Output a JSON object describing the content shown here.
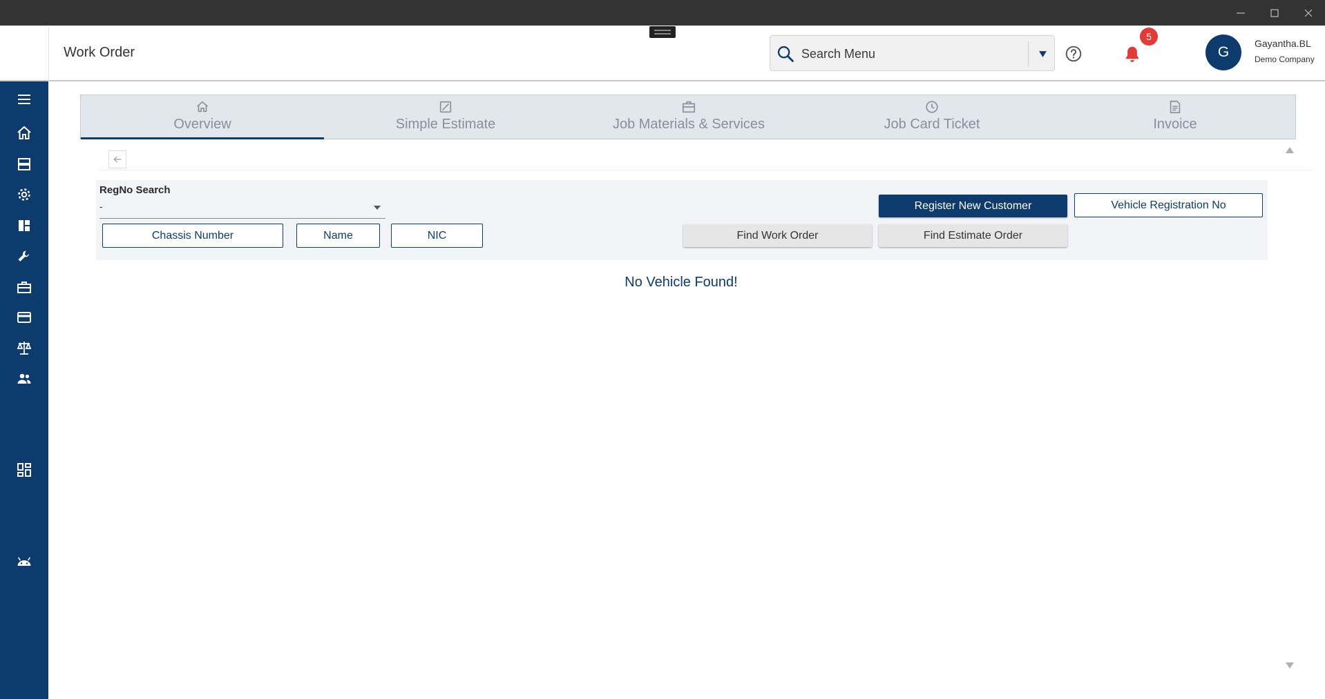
{
  "window": {
    "controls": [
      "minimize",
      "maximize",
      "close"
    ]
  },
  "header": {
    "title": "Work Order",
    "search": {
      "placeholder": "Search Menu",
      "value": ""
    },
    "notifications": {
      "count": "5"
    },
    "user": {
      "initial": "G",
      "name": "Gayantha.BL",
      "company": "Demo Company"
    }
  },
  "sidebar": {
    "items": [
      {
        "icon": "menu-icon"
      },
      {
        "icon": "home-icon"
      },
      {
        "icon": "storage-icon"
      },
      {
        "icon": "settings-icon"
      },
      {
        "icon": "dashboard-icon"
      },
      {
        "icon": "wrench-icon"
      },
      {
        "icon": "toolbox-icon"
      },
      {
        "icon": "credit-card-icon"
      },
      {
        "icon": "scale-icon"
      },
      {
        "icon": "people-icon"
      },
      {
        "icon": "apps-icon"
      },
      {
        "icon": "android-icon"
      }
    ]
  },
  "tabs": [
    {
      "label": "Overview",
      "icon": "home-icon",
      "active": true
    },
    {
      "label": "Simple Estimate",
      "icon": "estimate-icon",
      "active": false
    },
    {
      "label": "Job Materials & Services",
      "icon": "briefcase-icon",
      "active": false
    },
    {
      "label": "Job Card Ticket",
      "icon": "clock-icon",
      "active": false
    },
    {
      "label": "Invoice",
      "icon": "invoice-icon",
      "active": false
    }
  ],
  "search_panel": {
    "regno_label": "RegNo Search",
    "regno_value": "-",
    "chassis_label": "Chassis Number",
    "name_label": "Name",
    "nic_label": "NIC",
    "find_work_order": "Find Work Order",
    "find_estimate_order": "Find Estimate Order",
    "register_customer": "Register New Customer",
    "vehicle_reg_no": "Vehicle Registration No"
  },
  "result": {
    "message": "No Vehicle Found!"
  },
  "colors": {
    "primary": "#0d3b6e",
    "badge": "#e53935",
    "titlebar": "#333333",
    "panel": "#f2f4f8",
    "tabs": "#e2e7ee"
  }
}
